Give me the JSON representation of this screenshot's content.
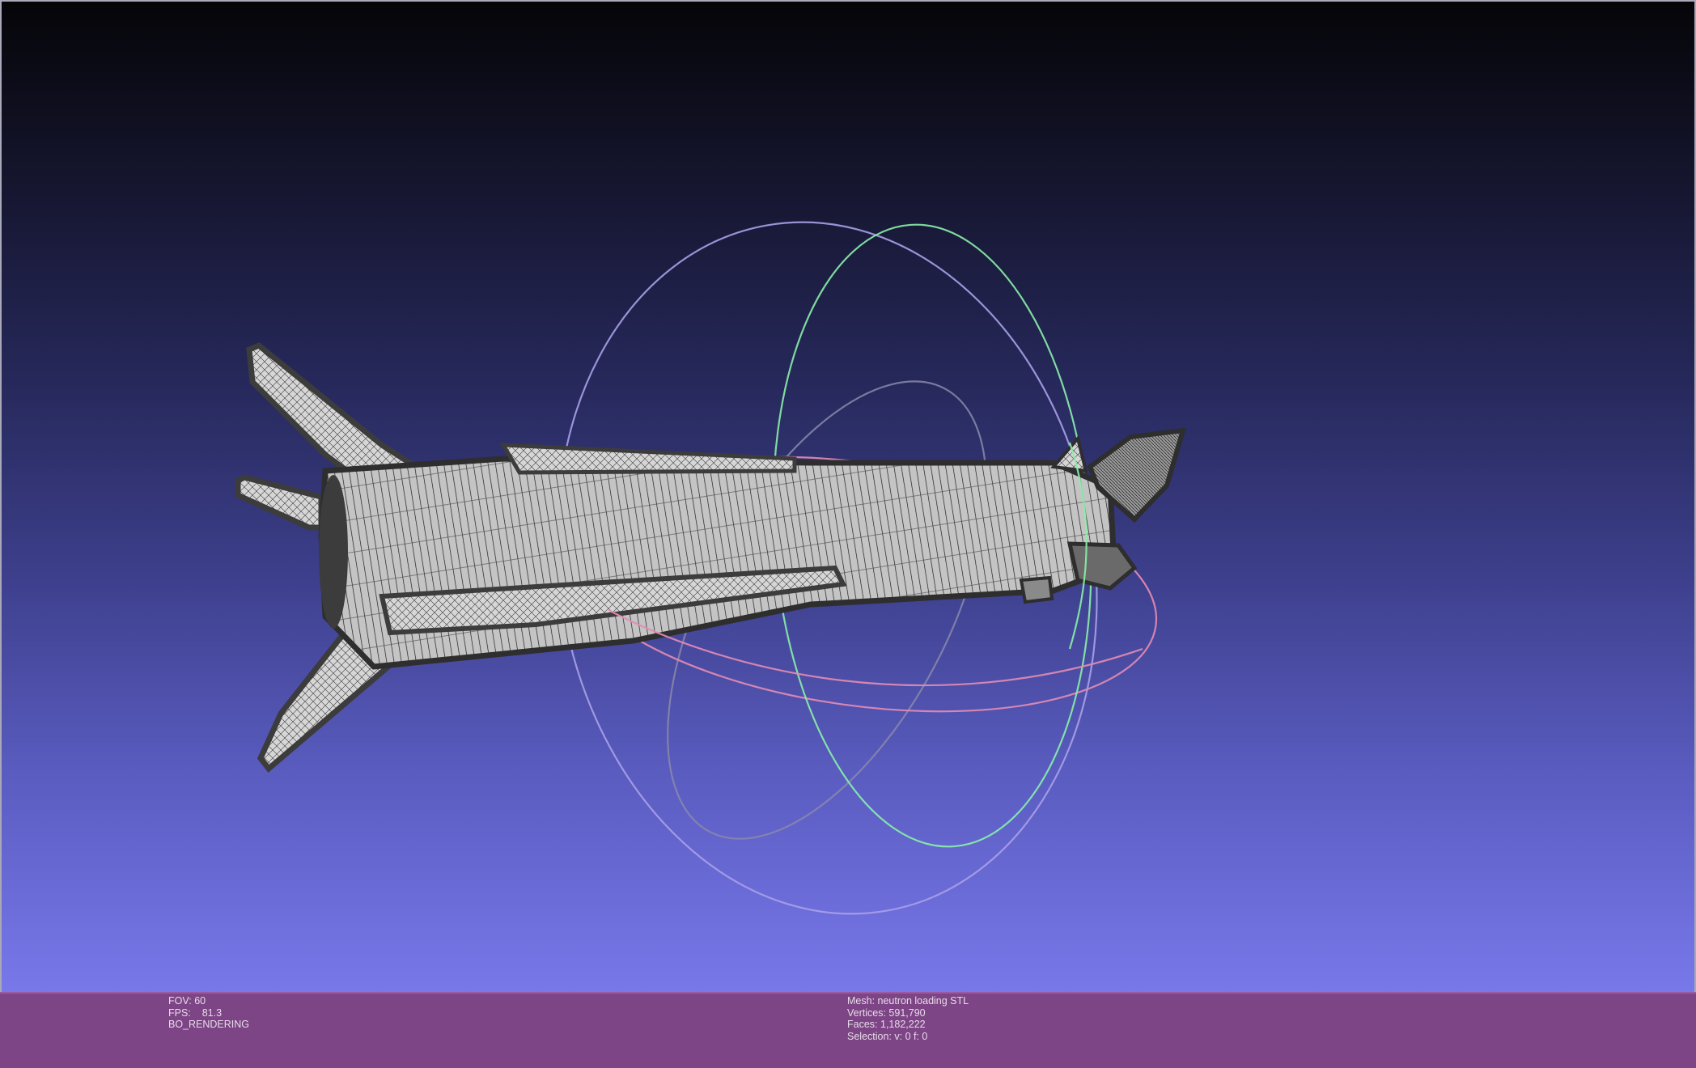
{
  "viewer": {
    "model": "neutron rocket mesh (wireframe)",
    "trackball": {
      "colors": {
        "x_ring": "#e48cb4",
        "y_ring": "#8af0a8",
        "z_ring": "#b8a8ff",
        "guide": "#8a88aa"
      }
    },
    "background": {
      "top": "#050508",
      "bottom": "#7878ea"
    }
  },
  "info": {
    "left": {
      "fov_label": "FOV:",
      "fov_value": "60",
      "fps_label": "FPS:",
      "fps_value": "81.3",
      "render_mode": "BO_RENDERING"
    },
    "right": {
      "mesh_label": "Mesh:",
      "mesh_value": "neutron loading STL",
      "vertices_label": "Vertices:",
      "vertices_value": "591,790",
      "faces_label": "Faces:",
      "faces_value": "1,182,222",
      "selection_label": "Selection:",
      "selection_value": "v: 0 f: 0"
    }
  }
}
